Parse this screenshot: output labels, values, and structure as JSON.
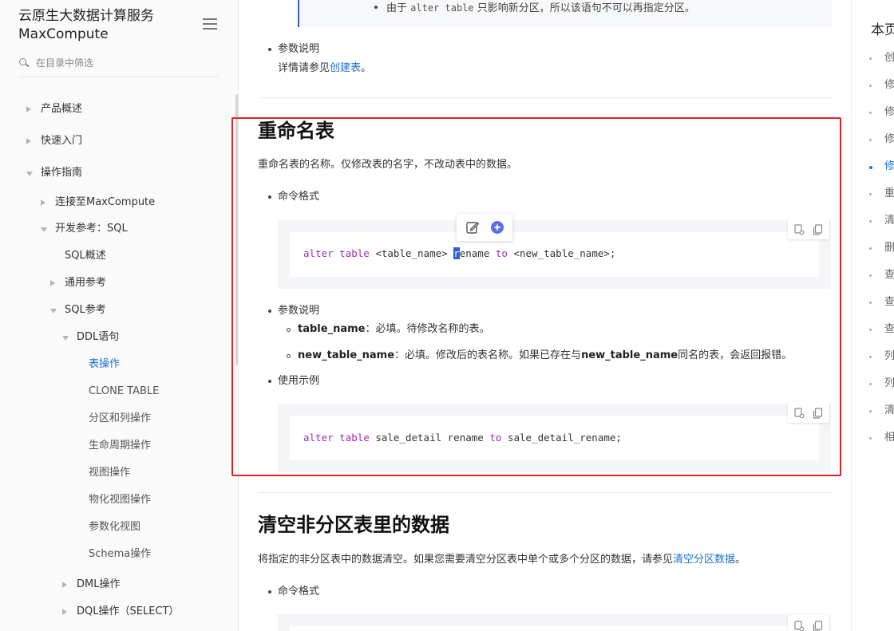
{
  "sidebar": {
    "title_line1": "云原生大数据计算服务",
    "title_line2": "MaxCompute",
    "search_placeholder": "在目录中筛选",
    "items": [
      {
        "label": "产品概述",
        "state": "collapsed"
      },
      {
        "label": "快速入门",
        "state": "collapsed"
      },
      {
        "label": "操作指南",
        "state": "expanded"
      },
      {
        "label": "连接至MaxCompute",
        "state": "collapsed"
      },
      {
        "label": "开发参考：SQL",
        "state": "expanded"
      },
      {
        "label": "SQL概述",
        "state": "leaf"
      },
      {
        "label": "通用参考",
        "state": "collapsed"
      },
      {
        "label": "SQL参考",
        "state": "expanded"
      },
      {
        "label": "DDL语句",
        "state": "expanded"
      },
      {
        "label": "表操作",
        "state": "active"
      },
      {
        "label": "CLONE TABLE",
        "state": "leaf"
      },
      {
        "label": "分区和列操作",
        "state": "leaf"
      },
      {
        "label": "生命周期操作",
        "state": "leaf"
      },
      {
        "label": "视图操作",
        "state": "leaf"
      },
      {
        "label": "物化视图操作",
        "state": "leaf"
      },
      {
        "label": "参数化视图",
        "state": "leaf"
      },
      {
        "label": "Schema操作",
        "state": "leaf"
      },
      {
        "label": "DML操作",
        "state": "collapsed"
      },
      {
        "label": "DQL操作（SELECT）",
        "state": "collapsed"
      }
    ]
  },
  "content": {
    "top_note_prefix": "由于",
    "top_note_code": "alter table",
    "top_note_suffix": "只影响新分区，所以该语句不可以再指定分区。",
    "params_label_1": "参数说明",
    "params_detail_prefix": "详情请参见",
    "params_detail_link": "创建表",
    "params_detail_suffix": "。",
    "section1": {
      "title": "重命名表",
      "desc": "重命名表的名称。仅修改表的名字，不改动表中的数据。",
      "cmd_label": "命令格式",
      "code_kw1": "alter",
      "code_kw2": "table",
      "code_a": "<table_name>",
      "code_cursor": "r",
      "code_b": "ename",
      "code_kw3": "to",
      "code_c": "<new_table_name>;",
      "params_label": "参数说明",
      "param1_name": "table_name",
      "param1_desc": "：必填。待修改名称的表。",
      "param2_name": "new_table_name",
      "param2_desc_a": "：必填。修改后的表名称。如果已存在与",
      "param2_name_b": "new_table_name",
      "param2_desc_b": "同名的表，会返回报错。",
      "example_label": "使用示例",
      "ex_kw1": "alter",
      "ex_kw2": "table",
      "ex_a": "sale_detail rename",
      "ex_kw3": "to",
      "ex_b": "sale_detail_rename;"
    },
    "section2": {
      "title": "清空非分区表里的数据",
      "desc_prefix": "将指定的非分区表中的数据清空。如果您需要清空分区表中单个或多个分区的数据，请参见",
      "desc_link": "清空分区数据",
      "desc_suffix": "。",
      "cmd_label": "命令格式"
    }
  },
  "toc": {
    "title": "本页",
    "items": [
      {
        "label": "创",
        "active": false
      },
      {
        "label": "修",
        "active": false
      },
      {
        "label": "修",
        "active": false
      },
      {
        "label": "修",
        "active": false
      },
      {
        "label": "修",
        "active": true
      },
      {
        "label": "重",
        "active": false
      },
      {
        "label": "清",
        "active": false
      },
      {
        "label": "删",
        "active": false
      },
      {
        "label": "查",
        "active": false
      },
      {
        "label": "查",
        "active": false
      },
      {
        "label": "查",
        "active": false
      },
      {
        "label": "列",
        "active": false
      },
      {
        "label": "列",
        "active": false
      },
      {
        "label": "清",
        "active": false
      },
      {
        "label": "相",
        "active": false
      }
    ]
  },
  "colors": {
    "accent": "#1b6fd1",
    "highlight_box": "#e0242b",
    "keyword": "#9b2fae"
  },
  "icons": [
    "menu-icon",
    "search-icon",
    "edit-icon",
    "ai-assistant-icon",
    "copy-code-icon",
    "duplicate-icon"
  ]
}
